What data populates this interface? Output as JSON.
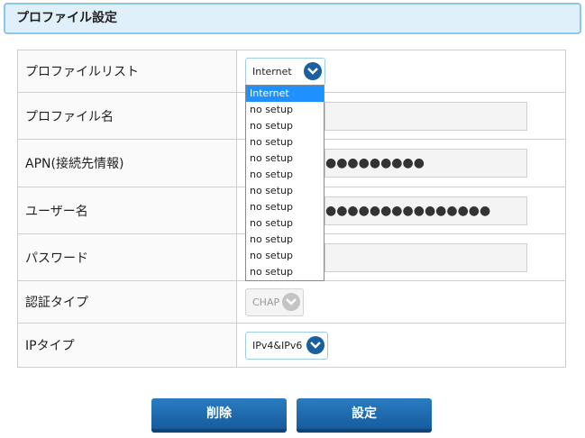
{
  "header": {
    "title": "プロファイル設定"
  },
  "rows": {
    "profile_list": {
      "label": "プロファイルリスト",
      "value": "Internet"
    },
    "profile_name": {
      "label": "プロファイル名",
      "value": ""
    },
    "apn": {
      "label": "APN(接続先情報)",
      "value": "●●●●●●●●●"
    },
    "username": {
      "label": "ユーザー名",
      "value": "●●●●●●●●●●●●●●●"
    },
    "password": {
      "label": "パスワード",
      "value": ""
    },
    "auth_type": {
      "label": "認証タイプ",
      "value": "CHAP"
    },
    "ip_type": {
      "label": "IPタイプ",
      "value": "IPv4&IPv6"
    }
  },
  "dropdown": {
    "options": [
      "Internet",
      "no setup",
      "no setup",
      "no setup",
      "no setup",
      "no setup",
      "no setup",
      "no setup",
      "no setup",
      "no setup",
      "no setup",
      "no setup"
    ]
  },
  "buttons": {
    "delete": "削除",
    "set": "設定"
  },
  "colors": {
    "accent": "#1a5f9e",
    "header_bg": "#dff0fb",
    "header_border": "#8cc6ea",
    "selected_option": "#1e90ff"
  }
}
